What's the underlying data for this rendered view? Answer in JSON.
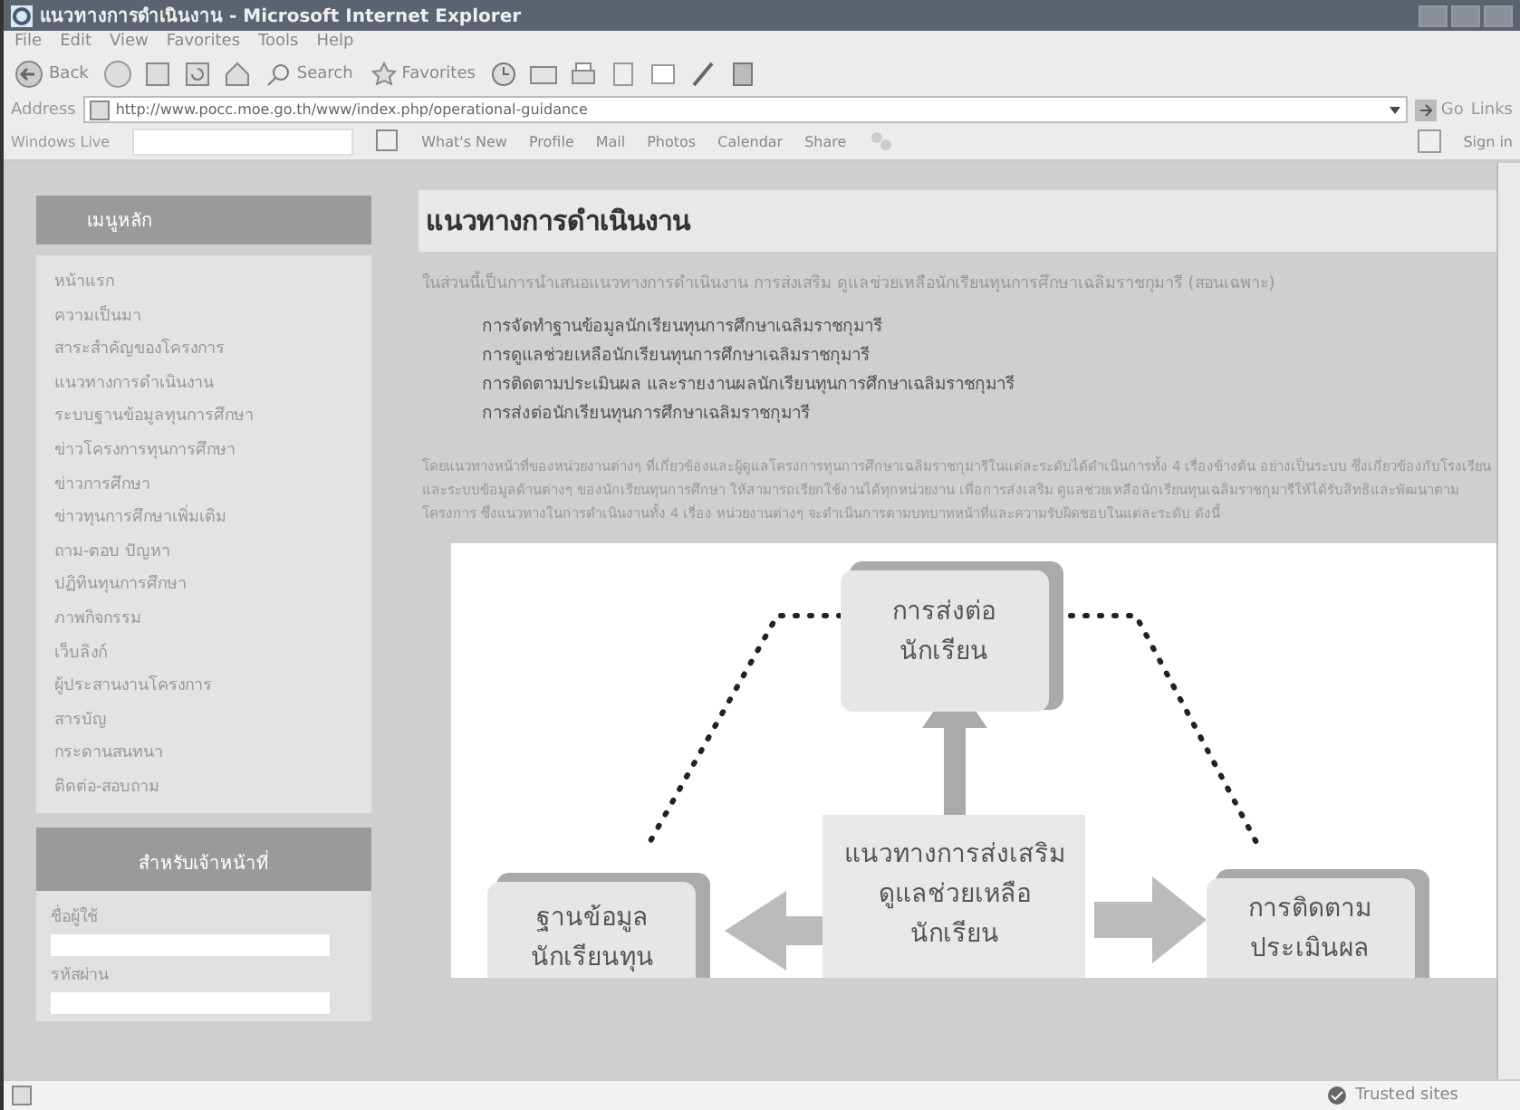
{
  "window": {
    "title": "แนวทางการดำเนินงาน - Microsoft Internet Explorer"
  },
  "menu_bar": [
    "File",
    "Edit",
    "View",
    "Favorites",
    "Tools",
    "Help"
  ],
  "toolbar": {
    "back": "Back",
    "search": "Search",
    "favorites": "Favorites"
  },
  "address_bar": {
    "label": "Address",
    "url": "http://www.pocc.moe.go.th/www/index.php/operational-guidance",
    "go": "Go",
    "links": "Links"
  },
  "live_toolbar": {
    "brand": "Windows Live",
    "items": [
      "What's New",
      "Profile",
      "Mail",
      "Photos",
      "Calendar",
      "Share"
    ],
    "sign_in": "Sign in"
  },
  "sidebar": {
    "menu_title": "เมนูหลัก",
    "items": [
      "หน้าแรก",
      "ความเป็นมา",
      "สาระสำคัญของโครงการ",
      "แนวทางการดำเนินงาน",
      "ระบบฐานข้อมูลทุนการศึกษา",
      "ข่าวโครงการทุนการศึกษา",
      "ข่าวการศึกษา",
      "ข่าวทุนการศึกษาเพิ่มเติม",
      "ถาม-ตอบ ปัญหา",
      "ปฏิทินทุนการศึกษา",
      "ภาพกิจกรรม",
      "เว็บลิงก์",
      "ผู้ประสานงานโครงการ",
      "สารบัญ",
      "กระดานสนทนา",
      "ติดต่อ-สอบถาม"
    ],
    "login": {
      "title": "สำหรับเจ้าหน้าที่",
      "username_label": "ชื่อผู้ใช้",
      "password_label": "รหัสผ่าน"
    }
  },
  "main": {
    "title": "แนวทางการดำเนินงาน",
    "intro": "ในส่วนนี้เป็นการนำเสนอแนวทางการดำเนินงาน การส่งเสริม ดูแลช่วยเหลือนักเรียนทุนการศึกษาเฉลิมราชกุมารี (สอนเฉพาะ)",
    "list": [
      "การจัดทำฐานข้อมูลนักเรียนทุนการศึกษาเฉลิมราชกุมารี",
      "การดูแลช่วยเหลือนักเรียนทุนการศึกษาเฉลิมราชกุมารี",
      "การติดตามประเมินผล และรายงานผลนักเรียนทุนการศึกษาเฉลิมราชกุมารี",
      "การส่งต่อนักเรียนทุนการศึกษาเฉลิมราชกุมารี"
    ],
    "paragraph": "โดยแนวทางหน้าที่ของหน่วยงานต่างๆ ที่เกี่ยวข้องและผู้ดูแลโครงการทุนการศึกษาเฉลิมราชกุมารีในแต่ละระดับได้ดำเนินการทั้ง 4 เรื่องข้างต้น อย่างเป็นระบบ ซึ่งเกี่ยวข้องกับโรงเรียนและระบบข้อมูลด้านต่างๆ ของนักเรียนทุนการศึกษา ให้สามารถเรียกใช้งานได้ทุกหน่วยงาน เพื่อการส่งเสริม ดูแลช่วยเหลือนักเรียนทุนเฉลิมราชกุมารีให้ได้รับสิทธิและพัฒนาตามโครงการ ซึ่งแนวทางในการดำเนินงานทั้ง 4 เรื่อง หน่วยงานต่างๆ จะดำเนินการตามบทบาทหน้าที่และความรับผิดชอบในแต่ละระดับ ดังนี้",
    "diagram": {
      "top": [
        "การส่งต่อ",
        "นักเรียน"
      ],
      "center": [
        "แนวทางการส่งเสริม",
        "ดูแลช่วยเหลือ",
        "นักเรียน"
      ],
      "left": [
        "ฐานข้อมูล",
        "นักเรียนทุน"
      ],
      "right": [
        "การติดตาม",
        "ประเมินผล"
      ]
    }
  },
  "status_bar": {
    "zone": "Trusted sites"
  }
}
